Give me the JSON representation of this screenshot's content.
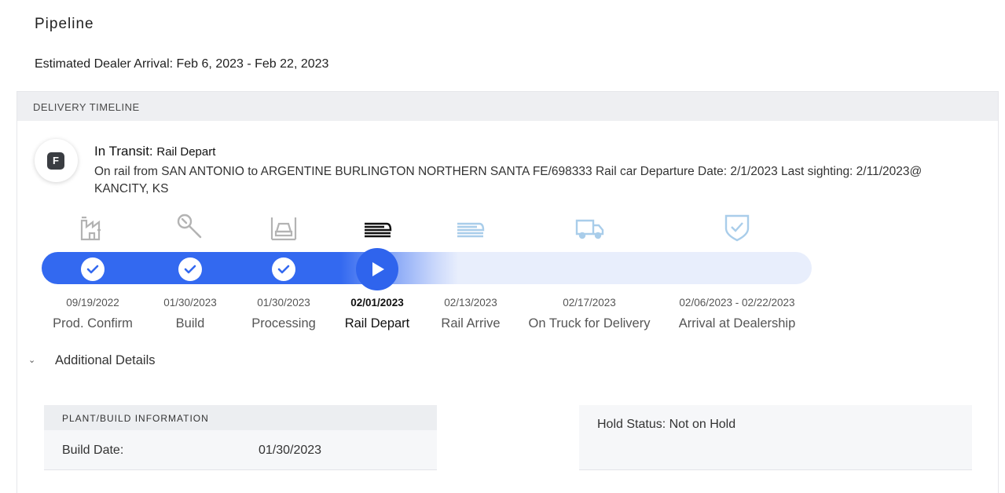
{
  "page": {
    "title": "Pipeline",
    "eta": "Estimated Dealer Arrival: Feb 6, 2023 - Feb 22, 2023"
  },
  "timeline": {
    "header": "DELIVERY TIMELINE",
    "badge": "F",
    "status_label": "In Transit:",
    "status_value": "Rail Depart",
    "description": "On rail from SAN ANTONIO to ARGENTINE BURLINGTON NORTHERN SANTA FE/698333 Rail car Departure Date: 2/1/2023 Last sighting: 2/11/2023@ KANCITY, KS",
    "steps": [
      {
        "date": "09/19/2022",
        "label": "Prod. Confirm",
        "icon": "factory-icon",
        "state": "done"
      },
      {
        "date": "01/30/2023",
        "label": "Build",
        "icon": "wrench-icon",
        "state": "done"
      },
      {
        "date": "01/30/2023",
        "label": "Processing",
        "icon": "car-lift-icon",
        "state": "done"
      },
      {
        "date": "02/01/2023",
        "label": "Rail Depart",
        "icon": "train-icon",
        "state": "current"
      },
      {
        "date": "02/13/2023",
        "label": "Rail Arrive",
        "icon": "train-icon",
        "state": "pending"
      },
      {
        "date": "02/17/2023",
        "label": "On Truck for Delivery",
        "icon": "truck-icon",
        "state": "pending"
      },
      {
        "date": "02/06/2023 - 02/22/2023",
        "label": "Arrival at Dealership",
        "icon": "shield-check-icon",
        "state": "pending"
      }
    ]
  },
  "details": {
    "toggle_label": "Additional Details",
    "plant": {
      "header": "PLANT/BUILD INFORMATION",
      "build_date_label": "Build Date:",
      "build_date_value": "01/30/2023"
    },
    "hold_status": "Hold Status: Not on Hold"
  },
  "colors": {
    "accent": "#2f64ed",
    "track_pending": "#e8eefc",
    "icon_done": "#b3b3b3",
    "icon_pending": "#a9cdea"
  }
}
